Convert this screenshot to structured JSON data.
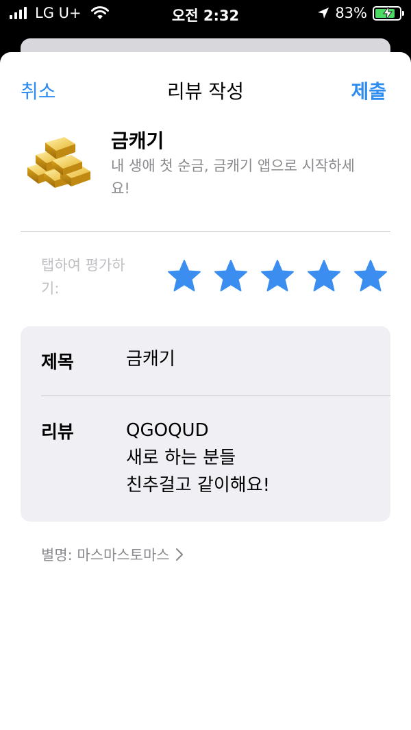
{
  "status_bar": {
    "carrier": "LG U+",
    "time": "오전 2:32",
    "battery_percent": "83%",
    "battery_level": 0.83,
    "icons": [
      "cellular-signal-icon",
      "wifi-icon",
      "location-arrow-icon",
      "battery-charging-icon"
    ]
  },
  "nav": {
    "cancel_label": "취소",
    "title": "리뷰 작성",
    "submit_label": "제출"
  },
  "app": {
    "name": "금캐기",
    "description": "내 생애 첫 순금, 금캐기 앱으로 시작하세요!",
    "icon": "gold-bars-icon"
  },
  "rating": {
    "label": "탭하여 평가하기:",
    "value": 5,
    "max": 5
  },
  "form": {
    "title_label": "제목",
    "title_value": "금캐기",
    "review_label": "리뷰",
    "review_lines": [
      "QGOQUD",
      "새로 하는 분들",
      "친추걸고 같이해요!"
    ]
  },
  "nickname": {
    "text": "별명: 마스마스토마스"
  },
  "colors": {
    "accent": "#2d8cf0",
    "star": "#3b8ef0",
    "secondary_text": "#8a8a8e",
    "form_background": "#efeff4"
  }
}
